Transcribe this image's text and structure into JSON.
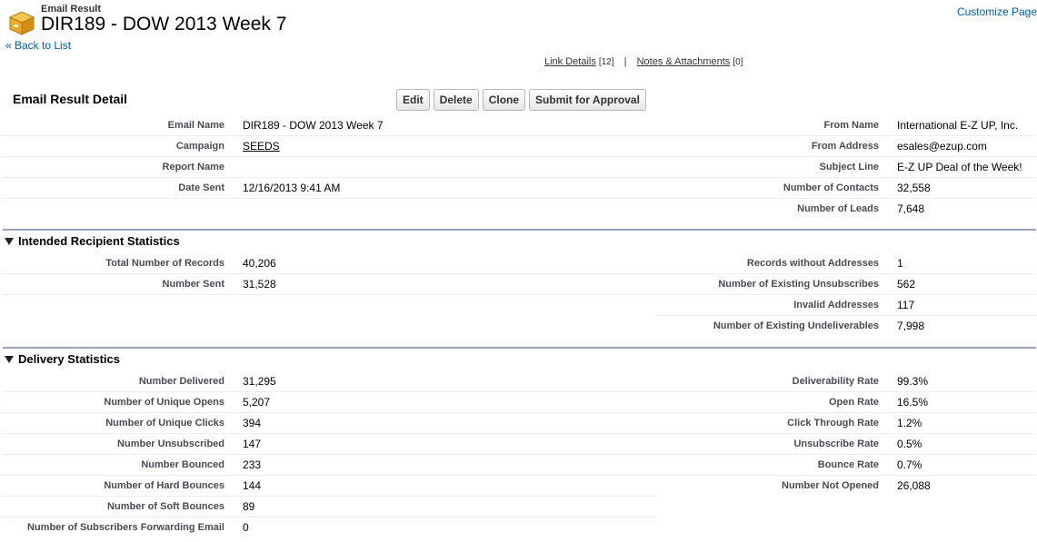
{
  "header": {
    "page_type": "Email Result",
    "title": "DIR189 - DOW 2013 Week 7",
    "back_link": "« Back to List",
    "customize": "Customize Page"
  },
  "related": {
    "link_details": "Link Details",
    "link_details_count": "[12]",
    "separator": "|",
    "notes": "Notes & Attachments",
    "notes_count": "[0]"
  },
  "detail": {
    "title": "Email Result Detail",
    "buttons": [
      "Edit",
      "Delete",
      "Clone",
      "Submit for Approval"
    ],
    "rows": [
      {
        "l_label": "Email Name",
        "l_value": "DIR189 - DOW 2013 Week 7",
        "r_label": "From Name",
        "r_value": "International E-Z UP, Inc."
      },
      {
        "l_label": "Campaign",
        "l_value": "SEEDS",
        "r_label": "From Address",
        "r_value": "esales@ezup.com"
      },
      {
        "l_label": "Report Name",
        "l_value": "",
        "r_label": "Subject Line",
        "r_value": "E-Z UP Deal of the Week!"
      },
      {
        "l_label": "Date Sent",
        "l_value": "12/16/2013 9:41 AM",
        "r_label": "Number of Contacts",
        "r_value": "32,558"
      },
      {
        "l_label": "",
        "l_value": "",
        "r_label": "Number of Leads",
        "r_value": "7,648"
      }
    ]
  },
  "intended": {
    "title": "Intended Recipient Statistics",
    "rows": [
      {
        "l_label": "Total Number of Records",
        "l_value": "40,206",
        "r_label": "Records without Addresses",
        "r_value": "1"
      },
      {
        "l_label": "Number Sent",
        "l_value": "31,528",
        "r_label": "Number of Existing Unsubscribes",
        "r_value": "562"
      },
      {
        "l_label": "",
        "l_value": "",
        "r_label": "Invalid Addresses",
        "r_value": "117"
      },
      {
        "l_label": "",
        "l_value": "",
        "r_label": "Number of Existing Undeliverables",
        "r_value": "7,998"
      }
    ]
  },
  "delivery": {
    "title": "Delivery Statistics",
    "rows": [
      {
        "l_label": "Number Delivered",
        "l_value": "31,295",
        "r_label": "Deliverability Rate",
        "r_value": "99.3%"
      },
      {
        "l_label": "Number of Unique Opens",
        "l_value": "5,207",
        "r_label": "Open Rate",
        "r_value": "16.5%"
      },
      {
        "l_label": "Number of Unique Clicks",
        "l_value": "394",
        "r_label": "Click Through Rate",
        "r_value": "1.2%"
      },
      {
        "l_label": "Number Unsubscribed",
        "l_value": "147",
        "r_label": "Unsubscribe Rate",
        "r_value": "0.5%"
      },
      {
        "l_label": "Number Bounced",
        "l_value": "233",
        "r_label": "Bounce Rate",
        "r_value": "0.7%"
      },
      {
        "l_label": "Number of Hard Bounces",
        "l_value": "144",
        "r_label": "Number Not Opened",
        "r_value": "26,088"
      },
      {
        "l_label": "Number of Soft Bounces",
        "l_value": "89",
        "r_label": "",
        "r_value": ""
      },
      {
        "l_label": "Number of Subscribers Forwarding Email",
        "l_value": "0",
        "r_label": "",
        "r_value": ""
      }
    ]
  }
}
